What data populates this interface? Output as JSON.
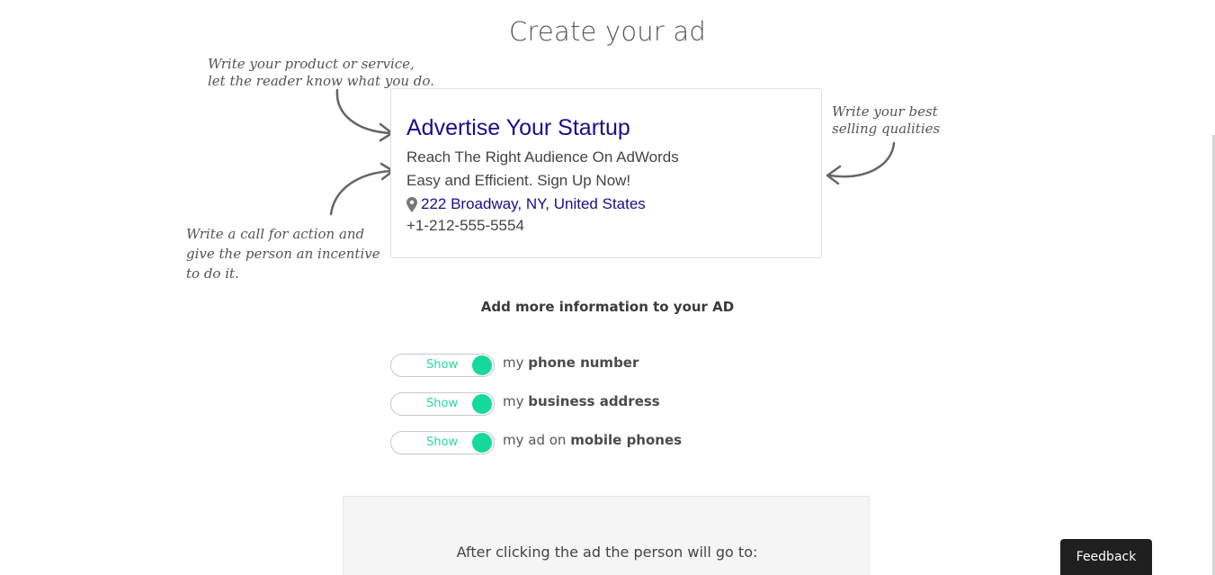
{
  "page": {
    "title": "Create your ad"
  },
  "hints": {
    "product_line1": "Write your product or service,",
    "product_line2": "let the reader know what you do.",
    "qualities_line1": "Write your best",
    "qualities_line2": "selling qualities",
    "cta_line1": "Write a call for action and",
    "cta_line2": "give the person an incentive",
    "cta_line3": "to do it."
  },
  "ad_preview": {
    "headline": "Advertise Your Startup",
    "description_line1": "Reach The Right Audience On AdWords",
    "description_line2": "Easy and Efficient. Sign Up Now!",
    "address": "222 Broadway, NY, United States",
    "phone": "+1-212-555-5554",
    "address_icon": "map-pin-icon"
  },
  "options": {
    "heading": "Add more information to your AD",
    "items": [
      {
        "toggle_label": "Show",
        "prefix": "my",
        "emphasis": "phone number",
        "enabled": true
      },
      {
        "toggle_label": "Show",
        "prefix": "my",
        "emphasis": "business address",
        "enabled": true
      },
      {
        "toggle_label": "Show",
        "prefix": "my ad on",
        "emphasis": "mobile phones",
        "enabled": true
      }
    ]
  },
  "destination": {
    "prompt": "After clicking the ad the person will go to:"
  },
  "feedback": {
    "label": "Feedback"
  },
  "colors": {
    "headline": "#1a0d8c",
    "toggle_accent": "#16d99b",
    "feedback_bg": "#1f1f1f"
  }
}
